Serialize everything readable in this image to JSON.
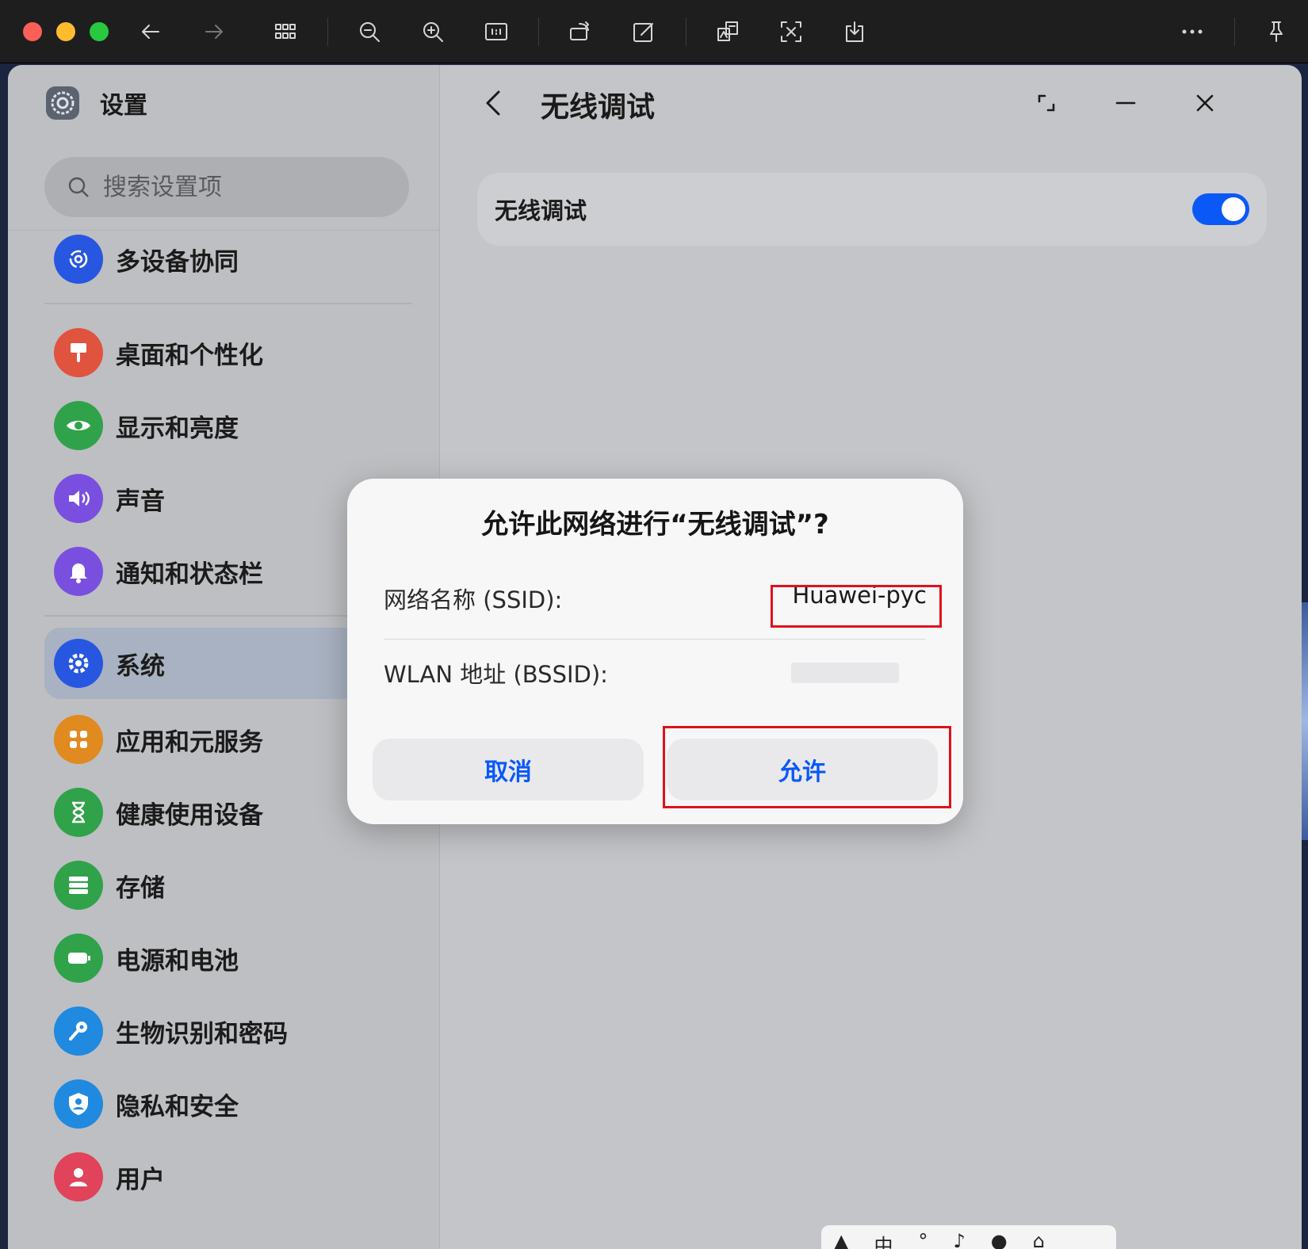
{
  "toolbar": {
    "icons": [
      "back-arrow-icon",
      "forward-arrow-icon",
      "grid-icon",
      "zoom-out-icon",
      "zoom-in-icon",
      "actual-size-icon",
      "rotate-icon",
      "edit-icon",
      "translate-icon",
      "ocr-icon",
      "download-icon",
      "more-icon",
      "pin-icon"
    ]
  },
  "sidebar": {
    "app_title": "设置",
    "search_placeholder": "搜索设置项",
    "items": [
      {
        "label": "多设备协同",
        "color": "#2757e0"
      },
      {
        "label": "桌面和个性化",
        "color": "#e0533f"
      },
      {
        "label": "显示和亮度",
        "color": "#30a24a"
      },
      {
        "label": "声音",
        "color": "#7a4fe0"
      },
      {
        "label": "通知和状态栏",
        "color": "#7a4fe0"
      },
      {
        "label": "系统",
        "color": "#2757e0"
      },
      {
        "label": "应用和元服务",
        "color": "#e08a1f"
      },
      {
        "label": "健康使用设备",
        "color": "#30a24a"
      },
      {
        "label": "存储",
        "color": "#30a24a"
      },
      {
        "label": "电源和电池",
        "color": "#30a24a"
      },
      {
        "label": "生物识别和密码",
        "color": "#1f8ae0"
      },
      {
        "label": "隐私和安全",
        "color": "#1f8ae0"
      },
      {
        "label": "用户",
        "color": "#e0435a"
      }
    ],
    "active_item": "系统"
  },
  "main": {
    "title": "无线调试",
    "card": {
      "label": "无线调试",
      "toggle_on": true
    }
  },
  "dialog": {
    "title": "允许此网络进行“无线调试”?",
    "ssid_label": "网络名称 (SSID):",
    "ssid_value": "Huawei-pyc",
    "bssid_label": "WLAN 地址 (BSSID):",
    "cancel_label": "取消",
    "allow_label": "允许"
  },
  "tray": {
    "items": [
      "中",
      "°",
      "♪"
    ]
  },
  "colors": {
    "accent": "#0a59f7",
    "highlight": "#e0111c"
  }
}
